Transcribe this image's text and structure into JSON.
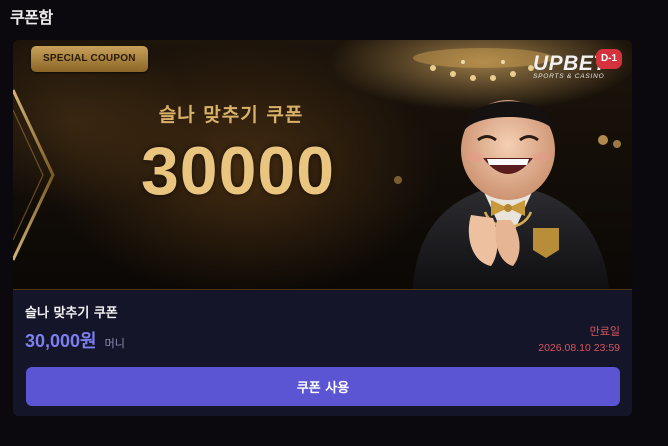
{
  "page": {
    "title": "쿠폰함"
  },
  "coupon": {
    "badge": "SPECIAL COUPON",
    "banner_subtitle": "슬나 맞추기 쿠폰",
    "banner_amount": "30000",
    "brand": {
      "logo_main": "UPBET",
      "logo_sub": "SPORTS & CASINO"
    },
    "dday": "D-1",
    "name": "슬나 맞추기 쿠폰",
    "amount": "30,000원",
    "amount_unit": "머니",
    "expiry_label": "만료일",
    "expiry_date": "2026.08.10 23:59",
    "use_button_label": "쿠폰 사용"
  },
  "colors": {
    "accent": "#5b55d4",
    "amount": "#7c7ff0",
    "expiry": "#d8545c",
    "gold": "#e9c580",
    "dday": "#d4323c"
  }
}
